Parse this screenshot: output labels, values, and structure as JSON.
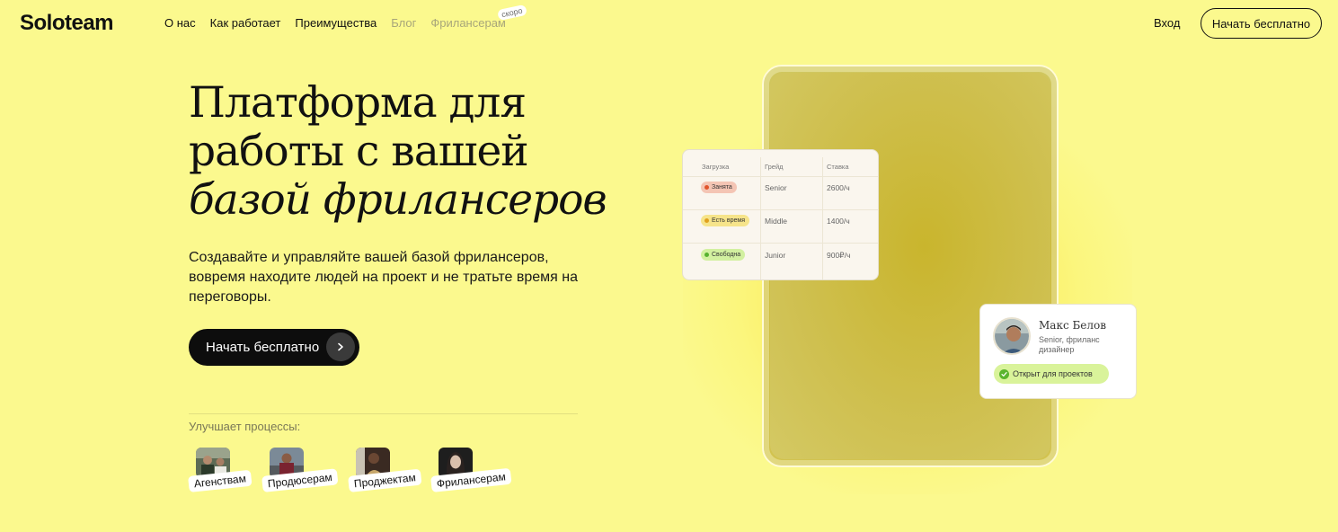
{
  "header": {
    "logo": "Soloteam",
    "nav": [
      {
        "label": "О нас"
      },
      {
        "label": "Как работает"
      },
      {
        "label": "Преимущества"
      },
      {
        "label": "Блог"
      },
      {
        "label": "Фрилансерам",
        "badge": "скоро"
      }
    ],
    "login": "Вход",
    "cta": "Начать бесплатно"
  },
  "hero": {
    "title_line1": "Платформа для",
    "title_line2": "работы с вашей",
    "title_line3": "базой фрилансеров",
    "description": "Создавайте и управляйте вашей базой фрилансеров, вовремя находите людей на проект и не тратьте время на переговоры.",
    "cta": "Начать бесплатно",
    "improves_label": "Улучшает процессы:",
    "roles": [
      {
        "label": "Агенствам"
      },
      {
        "label": "Продюсерам"
      },
      {
        "label": "Проджектам"
      },
      {
        "label": "Фрилансерам"
      }
    ]
  },
  "table_card": {
    "headers": [
      "Загрузка",
      "Грейд",
      "Ставка"
    ],
    "rows": [
      {
        "status": "Занята",
        "status_color": "#f4c5b4",
        "dot": "#e0552d",
        "grade": "Senior",
        "rate": "2600/ч"
      },
      {
        "status": "Есть время",
        "status_color": "#f6e48a",
        "dot": "#e0a11e",
        "grade": "Middle",
        "rate": "1400/ч"
      },
      {
        "status": "Свободна",
        "status_color": "#d2f0a0",
        "dot": "#57b130",
        "grade": "Junior",
        "rate": "900₽/ч"
      }
    ]
  },
  "profile_card": {
    "name": "Макс Белов",
    "role": "Senior, фриланс дизайнер",
    "status": "Открыт для проектов"
  },
  "colors": {
    "background": "#fbf98e",
    "dark": "#0d0d0d",
    "tablet": "#cdbc3a"
  }
}
